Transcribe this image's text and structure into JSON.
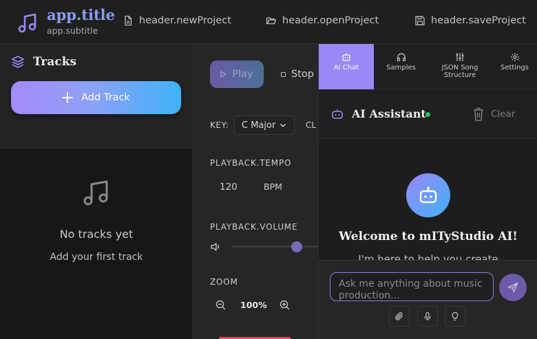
{
  "app": {
    "title": "app.title",
    "subtitle": "app.subtitle",
    "accent": "#9b87f5"
  },
  "header": {
    "newProject": "header.newProject",
    "openProject": "header.openProject",
    "saveProject": "header.saveProject",
    "icons": [
      "music-note-icon",
      "file-icon",
      "folder-open-icon",
      "save-icon"
    ]
  },
  "tracks": {
    "title": "Tracks",
    "add_label": "Add Track",
    "empty_title": "No tracks yet",
    "empty_sub": "Add your first track"
  },
  "controls": {
    "play_label": "Play",
    "stop_label": "Stop",
    "key_label": "KEY:",
    "key_value": "C Major",
    "clip_label": "CL",
    "tempo_label": "PLAYBACK.TEMPO",
    "tempo_value": "120",
    "tempo_unit": "BPM",
    "volume_label": "PLAYBACK.VOLUME",
    "volume_level": 0.7,
    "zoom_label": "ZOOM",
    "zoom_value": "100%"
  },
  "ai": {
    "tabs": [
      {
        "label": "AI Chat",
        "icon": "bot-icon",
        "active": true
      },
      {
        "label": "Samples",
        "icon": "headphones-icon",
        "active": false
      },
      {
        "label": "JSON Song Structure",
        "icon": "sliders-icon",
        "active": false
      },
      {
        "label": "Settings",
        "icon": "gear-icon",
        "active": false
      }
    ],
    "title": "AI Assistant",
    "status_color": "#22c55e",
    "clear_label": "Clear",
    "welcome": "Welcome to mITyStudio AI!",
    "welcome_sub": "I'm here to help you create",
    "input_placeholder": "Ask me anything about music production..."
  }
}
